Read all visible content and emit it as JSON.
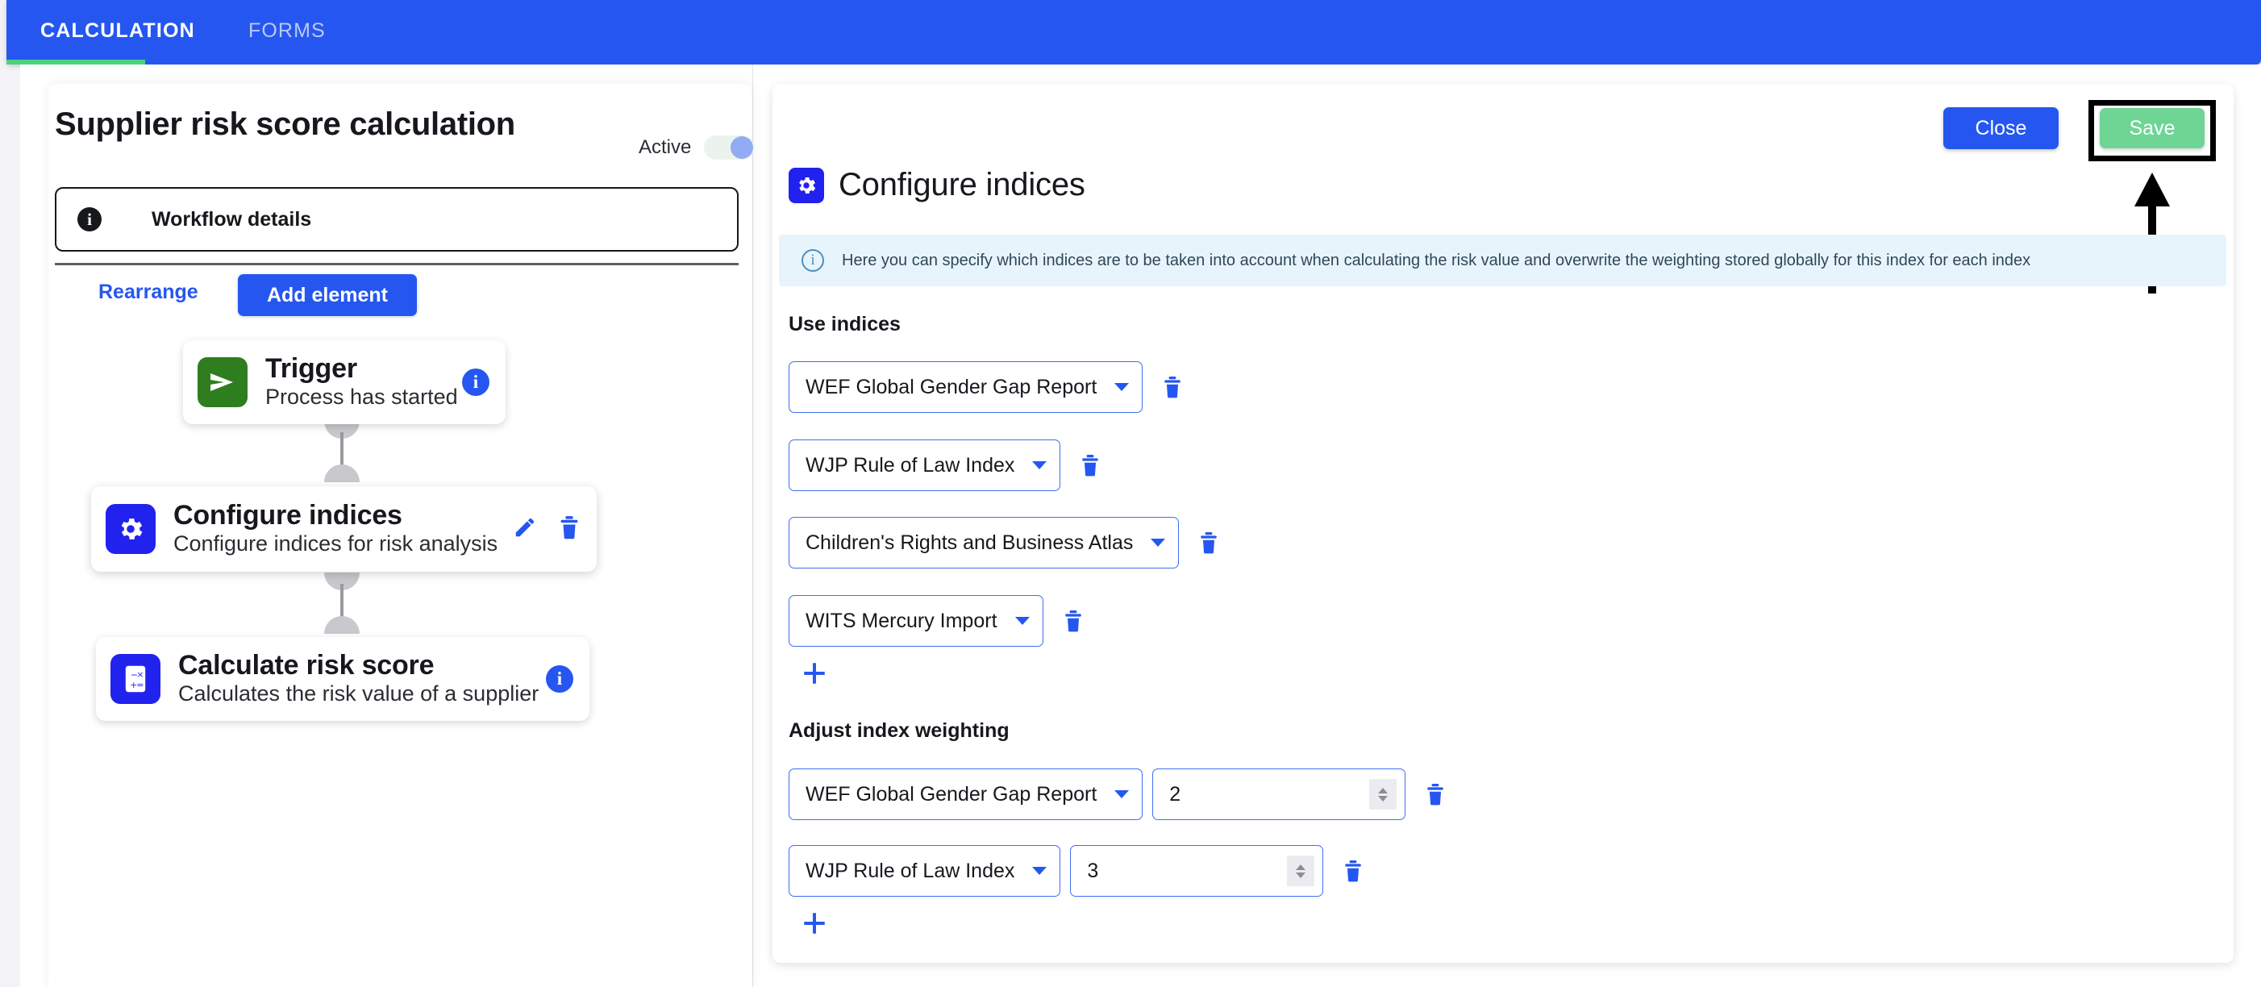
{
  "tabs": [
    {
      "label": "CALCULATION",
      "active": true
    },
    {
      "label": "FORMS",
      "active": false
    }
  ],
  "workflow": {
    "title": "Supplier risk score calculation",
    "active_label": "Active",
    "active_on": true,
    "details_label": "Workflow details",
    "rearrange_label": "Rearrange",
    "add_element_label": "Add element",
    "nodes": [
      {
        "title": "Trigger",
        "subtitle": "Process has started",
        "icon": "trigger-send-icon",
        "icon_color": "#2e7d1e",
        "actions": [
          "info-badge"
        ]
      },
      {
        "title": "Configure indices",
        "subtitle": "Configure indices for risk analysis",
        "icon": "gear-icon",
        "icon_color": "#2222ee",
        "actions": [
          "edit-pencil-icon",
          "trash-icon"
        ]
      },
      {
        "title": "Calculate risk score",
        "subtitle": "Calculates the risk value of a supplier",
        "icon": "calculator-icon",
        "icon_color": "#2222ee",
        "actions": [
          "info-badge"
        ]
      }
    ]
  },
  "panel": {
    "title": "Configure indices",
    "title_icon": "gear-icon",
    "close_label": "Close",
    "save_label": "Save",
    "save_color": "#6ed595",
    "close_color": "#2557f0",
    "banner": {
      "icon": "info-circle-icon",
      "text": "Here you can specify which indices are to be taken into account when calculating the risk value and overwrite the weighting stored globally for this index for each index"
    },
    "use_indices": {
      "label": "Use indices",
      "rows": [
        {
          "value": "WEF Global Gender Gap Report"
        },
        {
          "value": "WJP Rule of Law Index"
        },
        {
          "value": "Children's Rights and Business Atlas"
        },
        {
          "value": "WITS Mercury Import"
        }
      ],
      "add_label": "+"
    },
    "weighting": {
      "label": "Adjust index weighting",
      "rows": [
        {
          "index": "WEF Global Gender Gap Report",
          "weight": "2"
        },
        {
          "index": "WJP Rule of Law Index",
          "weight": "3"
        }
      ],
      "add_label": "+"
    }
  },
  "annotation": {
    "target": "save-button",
    "color": "#000000"
  }
}
